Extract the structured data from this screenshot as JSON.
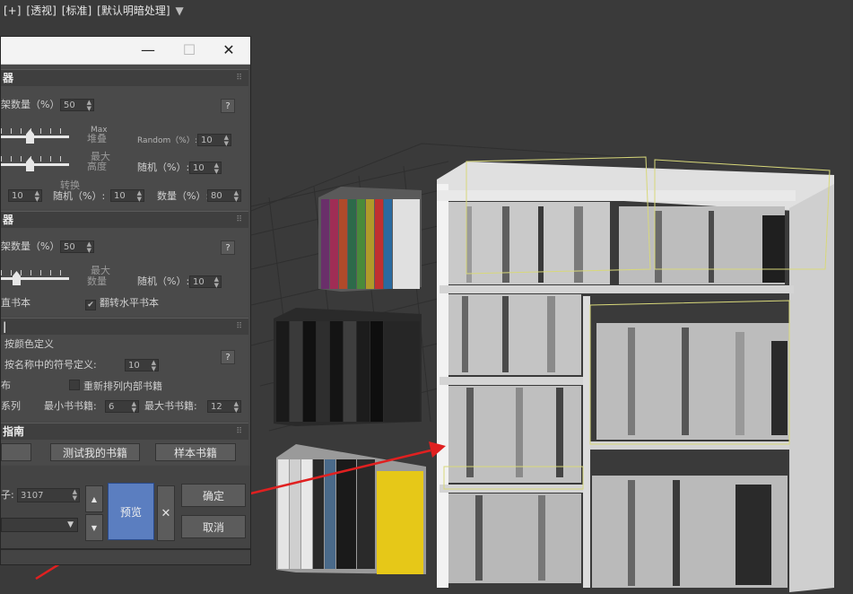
{
  "viewport": {
    "labels": [
      "[+]",
      "[透视]",
      "[标准]",
      "[默认明暗处理]"
    ],
    "filter_icon": "filter-icon",
    "background_color": "#3a3a3a"
  },
  "titlebar": {
    "minimize": "—",
    "maximize": "☐",
    "close": "✕"
  },
  "section1": {
    "title": "器",
    "shelf_count_label": "架数量（%）:",
    "shelf_count_value": "50",
    "max_label": "Max",
    "stack_label": "堆叠",
    "random_label": "Random（%）:",
    "random_value": "10",
    "max2_label": "最大",
    "height_label": "高度",
    "random_cn_label": "随机（%）:",
    "random_cn_value": "10",
    "left_value": "10",
    "rotate_label": "转换",
    "rotate_random_label": "随机（%）:",
    "rotate_random_value": "10",
    "count_label": "数量（%）:",
    "count_value": "80",
    "help": "?"
  },
  "section2": {
    "title": "器",
    "shelf_count_label": "架数量（%）:",
    "shelf_count_value": "50",
    "max_label": "最大",
    "count_label": "数量",
    "random_label": "随机（%）:",
    "random_value": "10",
    "vertical_label": "直书本",
    "flip_label": "翻转水平书本",
    "help": "?"
  },
  "section3": {
    "title": "|",
    "by_color_label": "按颜色定义",
    "by_symbol_label": "按名称中的符号定义:",
    "symbol_value": "10",
    "distribute_label": "布",
    "reorder_label": "重新排列内部书籍",
    "series_label": "系列",
    "min_books_label": "最小书书籍:",
    "min_books_value": "6",
    "max_books_label": "最大书书籍:",
    "max_books_value": "12",
    "help": "?"
  },
  "section4": {
    "title": "指南",
    "test_button": "测试我的书籍",
    "sample_button": "样本书籍"
  },
  "bottom": {
    "seed_label": "子:",
    "seed_value": "3107",
    "preview_button": "预览",
    "ok_button": "确定",
    "cancel_button": "取消",
    "close_x": "✕"
  },
  "colors": {
    "accent_preview": "#5b7ec0",
    "annotation_arrow": "#e02020",
    "shelf": "#d9d9d9",
    "selection_box": "#d8d87a"
  }
}
